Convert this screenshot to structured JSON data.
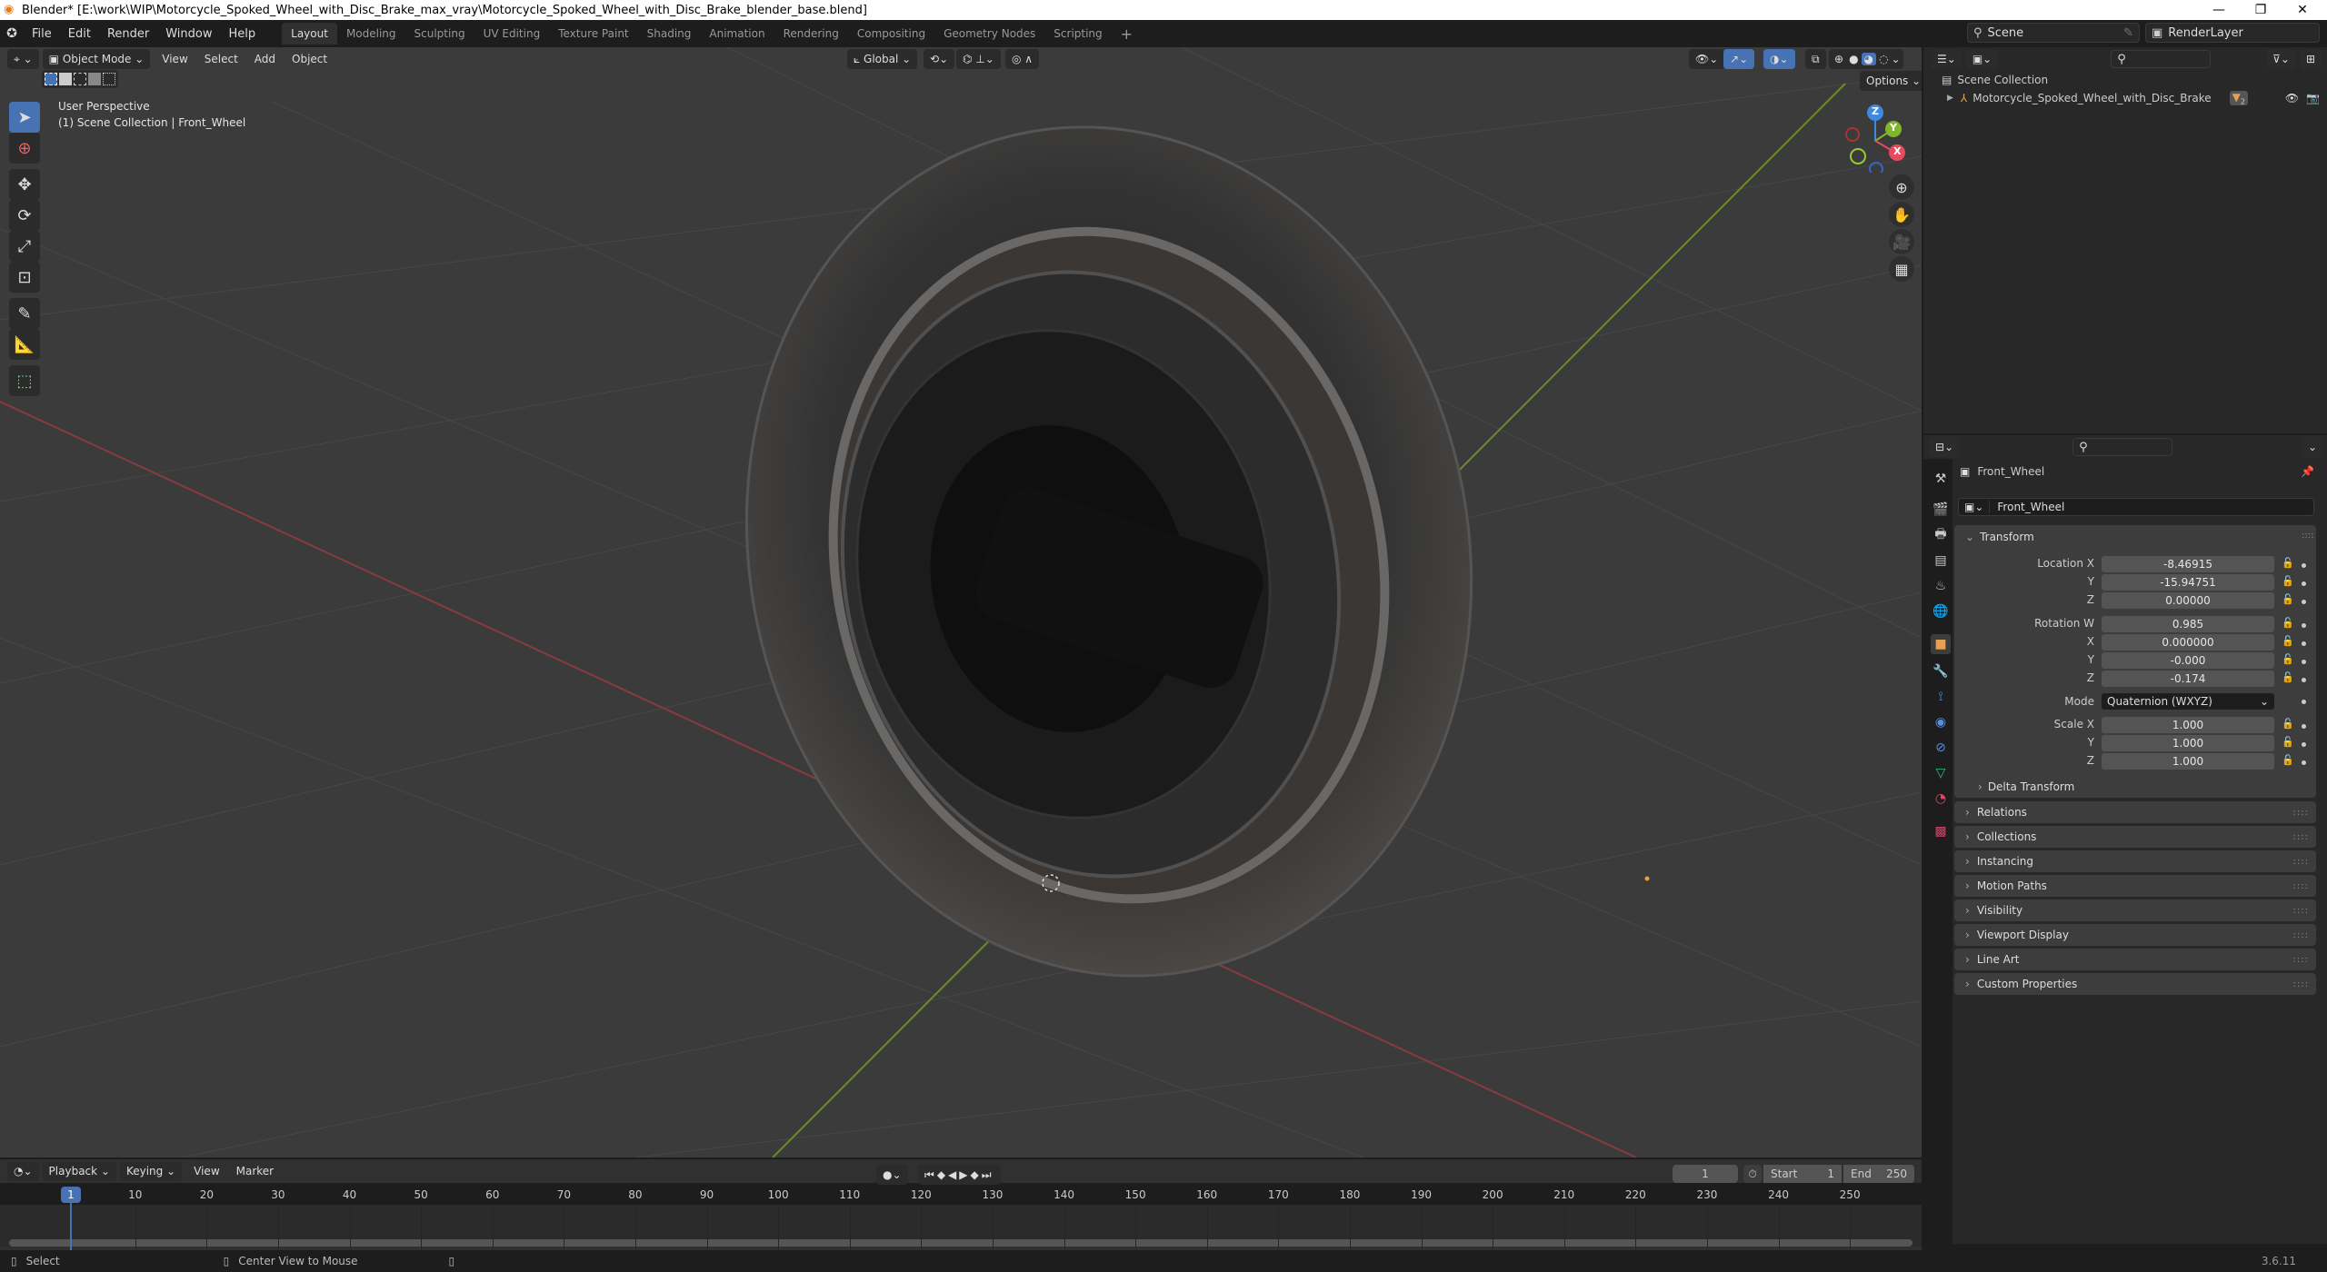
{
  "window": {
    "title": "Blender* [E:\\work\\WIP\\Motorcycle_Spoked_Wheel_with_Disc_Brake_max_vray\\Motorcycle_Spoked_Wheel_with_Disc_Brake_blender_base.blend]",
    "minimize": "—",
    "maximize": "❐",
    "close": "✕"
  },
  "menu": [
    "File",
    "Edit",
    "Render",
    "Window",
    "Help"
  ],
  "workspaces": [
    "Layout",
    "Modeling",
    "Sculpting",
    "UV Editing",
    "Texture Paint",
    "Shading",
    "Animation",
    "Rendering",
    "Compositing",
    "Geometry Nodes",
    "Scripting"
  ],
  "active_workspace": "Layout",
  "add_workspace": "+",
  "scene": {
    "name": "Scene",
    "view_layer": "RenderLayer"
  },
  "viewport": {
    "mode": "Object Mode",
    "menus": [
      "View",
      "Select",
      "Add",
      "Object"
    ],
    "transform_orientation": "Global",
    "options_label": "Options",
    "overlay_title": "User Perspective",
    "overlay_subtitle": "(1) Scene Collection | Front_Wheel",
    "gizmo": {
      "x": "X",
      "y": "Y",
      "z": "Z"
    },
    "shading_mode": "Material Preview"
  },
  "tools": [
    "select-box",
    "cursor",
    "move",
    "rotate",
    "scale",
    "transform",
    "annotate",
    "measure",
    "add-cube"
  ],
  "outliner": {
    "root": "Scene Collection",
    "items": [
      {
        "name": "Motorcycle_Spoked_Wheel_with_Disc_Brake",
        "badge": "2"
      }
    ]
  },
  "properties": {
    "object_name": "Front_Wheel",
    "data_name": "Front_Wheel",
    "transform_label": "Transform",
    "location": {
      "label": "Location X",
      "x": "-8.46915",
      "y": "-15.94751",
      "z": "0.00000"
    },
    "rotation": {
      "label": "Rotation W",
      "w": "0.985",
      "x": "0.000000",
      "y": "-0.000",
      "z": "-0.174"
    },
    "mode_label": "Mode",
    "mode_value": "Quaternion (WXYZ)",
    "scale": {
      "label": "Scale X",
      "x": "1.000",
      "y": "1.000",
      "z": "1.000"
    },
    "axis_labels": {
      "y": "Y",
      "z": "Z",
      "x": "X"
    },
    "delta_transform": "Delta Transform",
    "panels": [
      "Relations",
      "Collections",
      "Instancing",
      "Motion Paths",
      "Visibility",
      "Viewport Display",
      "Line Art",
      "Custom Properties"
    ]
  },
  "timeline": {
    "menus": [
      "Playback",
      "Keying",
      "View",
      "Marker"
    ],
    "current_frame": "1",
    "start_label": "Start",
    "start": "1",
    "end_label": "End",
    "end": "250",
    "ticks": [
      "10",
      "20",
      "30",
      "40",
      "50",
      "60",
      "70",
      "80",
      "90",
      "100",
      "110",
      "120",
      "130",
      "140",
      "150",
      "160",
      "170",
      "180",
      "190",
      "200",
      "210",
      "220",
      "230",
      "240",
      "250"
    ],
    "playhead": "1"
  },
  "statusbar": {
    "select": "Select",
    "center_view": "Center View to Mouse",
    "version": "3.6.11"
  },
  "colors": {
    "accent": "#4772b3",
    "x_axis": "#e84a5f",
    "y_axis": "#7fb62b",
    "z_axis": "#3d8ae0",
    "object_orange": "#e5a152"
  }
}
